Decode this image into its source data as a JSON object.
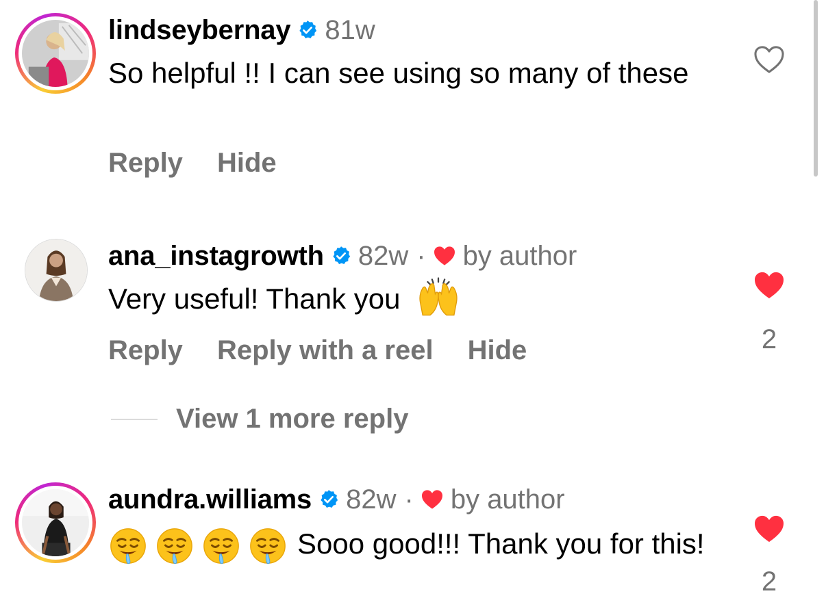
{
  "colors": {
    "secondary_text": "#737373",
    "verified_blue": "#0095f6",
    "like_red": "#ff3040"
  },
  "comments": [
    {
      "username": "lindseybernay",
      "time": "81w",
      "by_author": false,
      "text": "So helpful !! I can see using so many of these",
      "actions": [
        "Reply",
        "Hide"
      ],
      "liked": false,
      "like_count": ""
    },
    {
      "username": "ana_instagrowth",
      "time": "82w",
      "separator": "·",
      "by_author": true,
      "by_author_text": "by author",
      "text": "Very useful! Thank you",
      "trailing_emoji": "raising-hands",
      "actions": [
        "Reply",
        "Reply with a reel",
        "Hide"
      ],
      "liked": true,
      "like_count": "2",
      "view_more": "View 1 more reply"
    },
    {
      "username": "aundra.williams",
      "time": "82w",
      "separator": "·",
      "by_author": true,
      "by_author_text": "by author",
      "leading_emoji": [
        "drooling-face",
        "drooling-face",
        "drooling-face",
        "drooling-face"
      ],
      "text": "Sooo good!!! Thank you for this!",
      "liked": true,
      "like_count": "2"
    }
  ]
}
